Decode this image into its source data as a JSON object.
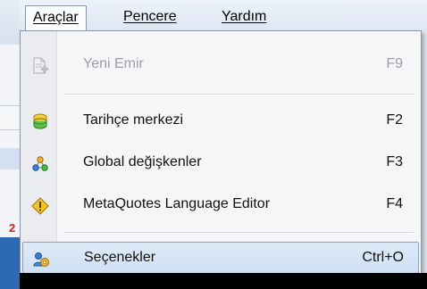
{
  "menubar": {
    "items": [
      {
        "label": "Araçlar",
        "active": true
      },
      {
        "label": "Pencere",
        "active": false
      },
      {
        "label": "Yardım",
        "active": false
      }
    ]
  },
  "menu": {
    "items": [
      {
        "label": "Yeni Emir",
        "shortcut": "F9",
        "icon": "new-order-icon",
        "enabled": false
      },
      {
        "label": "Tarihçe merkezi",
        "shortcut": "F2",
        "icon": "history-center-icon",
        "enabled": true
      },
      {
        "label": "Global değişkenler",
        "shortcut": "F3",
        "icon": "global-variables-icon",
        "enabled": true
      },
      {
        "label": "MetaQuotes Language Editor",
        "shortcut": "F4",
        "icon": "metaeditor-icon",
        "enabled": true
      },
      {
        "label": "Seçenekler",
        "shortcut": "Ctrl+O",
        "icon": "options-icon",
        "enabled": true,
        "selected": true
      }
    ]
  },
  "background": {
    "left_mark": "2"
  },
  "colors": {
    "selection_bg": "#cfe0f5",
    "selection_border": "#7fa3d3",
    "disabled_text": "#9aa0a8",
    "menu_bg": "#f5f6f7"
  }
}
